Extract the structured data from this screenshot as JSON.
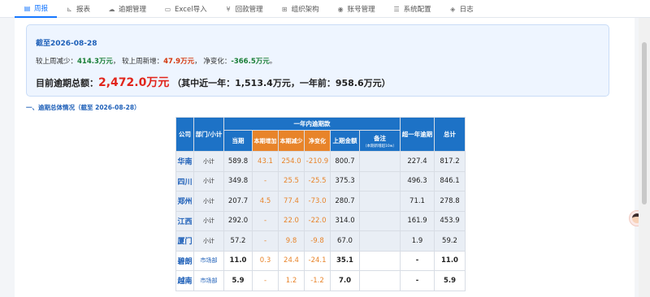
{
  "nav": {
    "items": [
      {
        "label": "周报",
        "icon": "document-icon",
        "glyph": "▤",
        "active": true
      },
      {
        "label": "报表",
        "icon": "chart-icon",
        "glyph": "⊾",
        "active": false
      },
      {
        "label": "逾期管理",
        "icon": "cloud-icon",
        "glyph": "☁",
        "active": false
      },
      {
        "label": "Excel导入",
        "icon": "file-icon",
        "glyph": "▭",
        "active": false
      },
      {
        "label": "回款管理",
        "icon": "yen-icon",
        "glyph": "¥",
        "active": false
      },
      {
        "label": "组织架构",
        "icon": "org-icon",
        "glyph": "⊞",
        "active": false
      },
      {
        "label": "账号管理",
        "icon": "user-icon",
        "glyph": "◉",
        "active": false
      },
      {
        "label": "系统配置",
        "icon": "settings-icon",
        "glyph": "☰",
        "active": false
      },
      {
        "label": "日志",
        "icon": "shield-icon",
        "glyph": "◈",
        "active": false
      }
    ]
  },
  "summary": {
    "date": "截至2026-08-28",
    "dec_label": "较上周减少：",
    "dec_value": "414.3万元",
    "inc_label": "较上周新增：",
    "inc_value": "47.9万元",
    "net_label": "净变化：",
    "net_value": "-366.5万元",
    "total_label": "目前逾期总额：",
    "total_value": "2,472.0万元",
    "total_detail": "（其中近一年：1,513.4万元，一年前：958.6万元）"
  },
  "section_title": "一、逾期总体情况（截至 2026-08-28）",
  "table": {
    "headers": {
      "company": "公司",
      "dept": "部门/小计",
      "within_year": "一年内逾期款",
      "current": "当期",
      "increase": "本期增加",
      "decrease": "本期减少",
      "net": "净变化",
      "last_amount": "上期金额",
      "remark": "备注",
      "remark_sub": "（本期新增超10w）",
      "over_year": "超一年逾期",
      "total": "总计"
    },
    "rows": [
      {
        "company": "华南",
        "dept": "小计",
        "current": "589.8",
        "increase": "43.1",
        "decrease": "254.0",
        "net": "-210.9",
        "last": "800.7",
        "remark": "",
        "over": "227.4",
        "total": "817.2"
      },
      {
        "company": "四川",
        "dept": "小计",
        "current": "349.8",
        "increase": "-",
        "decrease": "25.5",
        "net": "-25.5",
        "last": "375.3",
        "remark": "",
        "over": "496.3",
        "total": "846.1"
      },
      {
        "company": "郑州",
        "dept": "小计",
        "current": "207.7",
        "increase": "4.5",
        "decrease": "77.4",
        "net": "-73.0",
        "last": "280.7",
        "remark": "",
        "over": "71.1",
        "total": "278.8"
      },
      {
        "company": "江西",
        "dept": "小计",
        "current": "292.0",
        "increase": "-",
        "decrease": "22.0",
        "net": "-22.0",
        "last": "314.0",
        "remark": "",
        "over": "161.9",
        "total": "453.9"
      },
      {
        "company": "厦门",
        "dept": "小计",
        "current": "57.2",
        "increase": "-",
        "decrease": "9.8",
        "net": "-9.8",
        "last": "67.0",
        "remark": "",
        "over": "1.9",
        "total": "59.2"
      },
      {
        "company": "碧朗",
        "dept": "市场部",
        "current": "11.0",
        "increase": "0.3",
        "decrease": "24.4",
        "net": "-24.1",
        "last": "35.1",
        "remark": "",
        "over": "-",
        "total": "11.0"
      },
      {
        "company": "越南",
        "dept": "市场部",
        "current": "5.9",
        "increase": "-",
        "decrease": "1.2",
        "net": "-1.2",
        "last": "7.0",
        "remark": "",
        "over": "-",
        "total": "5.9"
      }
    ]
  }
}
